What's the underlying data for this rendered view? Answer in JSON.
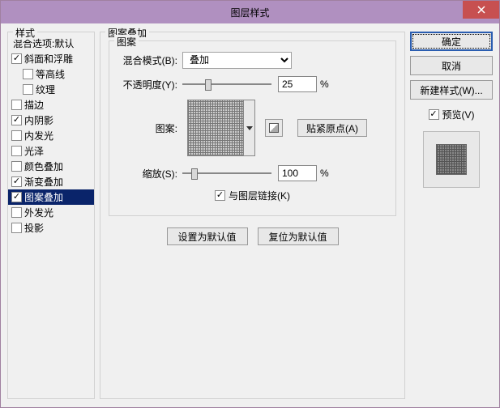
{
  "window": {
    "title": "图层样式"
  },
  "close": "×",
  "styles": {
    "legend": "样式",
    "blend_options": "混合选项:默认",
    "items": [
      {
        "label": "斜面和浮雕",
        "checked": true
      },
      {
        "label": "等高线",
        "checked": false,
        "indent": true
      },
      {
        "label": "纹理",
        "checked": false,
        "indent": true
      },
      {
        "label": "描边",
        "checked": false
      },
      {
        "label": "内阴影",
        "checked": true
      },
      {
        "label": "内发光",
        "checked": false
      },
      {
        "label": "光泽",
        "checked": false
      },
      {
        "label": "颜色叠加",
        "checked": false
      },
      {
        "label": "渐变叠加",
        "checked": true
      },
      {
        "label": "图案叠加",
        "checked": true,
        "selected": true
      },
      {
        "label": "外发光",
        "checked": false
      },
      {
        "label": "投影",
        "checked": false
      }
    ]
  },
  "panel": {
    "outer_legend": "图案叠加",
    "inner_legend": "图案",
    "blend_mode_label": "混合模式(B):",
    "blend_mode_value": "叠加",
    "opacity_label": "不透明度(Y):",
    "opacity_value": "25",
    "opacity_pct": "%",
    "pattern_label": "图案:",
    "snap_origin": "贴紧原点(A)",
    "scale_label": "缩放(S):",
    "scale_value": "100",
    "scale_pct": "%",
    "link_label": "与图层链接(K)",
    "set_default": "设置为默认值",
    "reset_default": "复位为默认值"
  },
  "right": {
    "ok": "确定",
    "cancel": "取消",
    "new_style": "新建样式(W)...",
    "preview": "预览(V)"
  }
}
